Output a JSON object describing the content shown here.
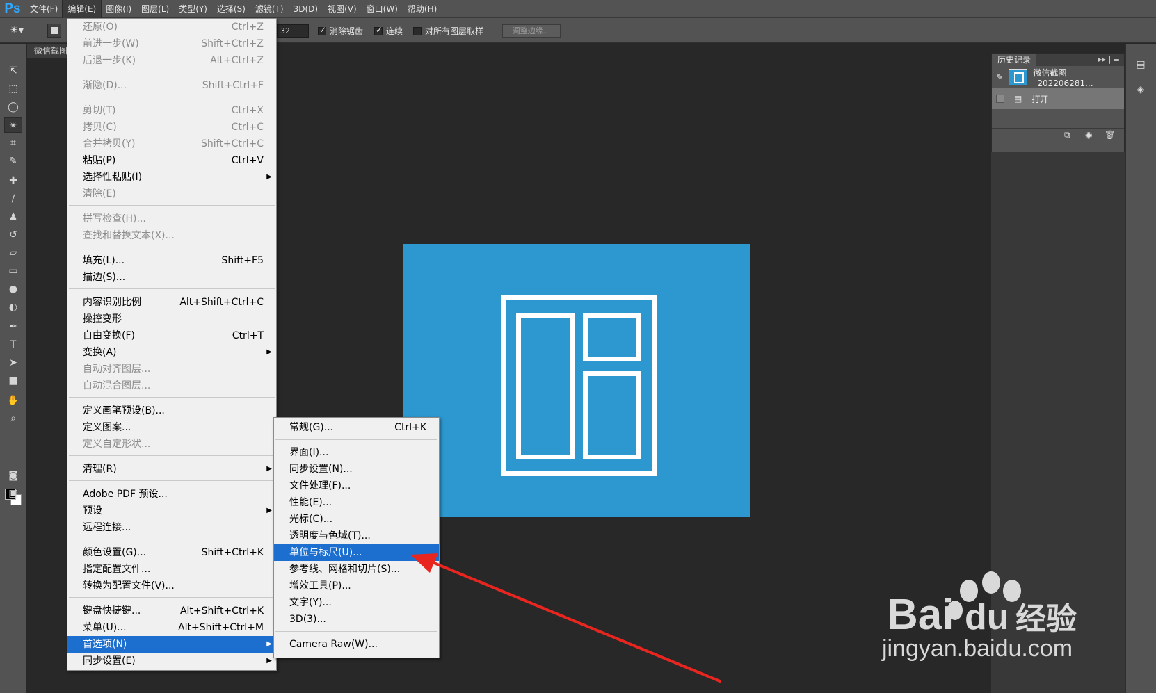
{
  "app": {
    "logo": "Ps"
  },
  "menubar": {
    "items": [
      "文件(F)",
      "编辑(E)",
      "图像(I)",
      "图层(L)",
      "类型(Y)",
      "选择(S)",
      "滤镜(T)",
      "3D(D)",
      "视图(V)",
      "窗口(W)",
      "帮助(H)"
    ],
    "active": "编辑(E)"
  },
  "options": {
    "tolerance": "32",
    "antialias_label": "消除锯齿",
    "contiguous_label": "连续",
    "all_layers_label": "对所有图层取样",
    "refine_button": "调整边缘..."
  },
  "document": {
    "tab_title": "微信截图"
  },
  "edit_menu": {
    "items": [
      {
        "label": "还原(O)",
        "shortcut": "Ctrl+Z",
        "disabled": true
      },
      {
        "label": "前进一步(W)",
        "shortcut": "Shift+Ctrl+Z",
        "disabled": true
      },
      {
        "label": "后退一步(K)",
        "shortcut": "Alt+Ctrl+Z",
        "disabled": true
      },
      {
        "label": "渐隐(D)...",
        "shortcut": "Shift+Ctrl+F",
        "disabled": true
      },
      {
        "label": "剪切(T)",
        "shortcut": "Ctrl+X",
        "disabled": true
      },
      {
        "label": "拷贝(C)",
        "shortcut": "Ctrl+C",
        "disabled": true
      },
      {
        "label": "合并拷贝(Y)",
        "shortcut": "Shift+Ctrl+C",
        "disabled": true
      },
      {
        "label": "粘贴(P)",
        "shortcut": "Ctrl+V",
        "disabled": false
      },
      {
        "label": "选择性粘贴(I)",
        "shortcut": "",
        "disabled": false,
        "submenu": true
      },
      {
        "label": "清除(E)",
        "shortcut": "",
        "disabled": true
      },
      {
        "label": "拼写检查(H)...",
        "shortcut": "",
        "disabled": true
      },
      {
        "label": "查找和替换文本(X)...",
        "shortcut": "",
        "disabled": true
      },
      {
        "label": "填充(L)...",
        "shortcut": "Shift+F5",
        "disabled": false
      },
      {
        "label": "描边(S)...",
        "shortcut": "",
        "disabled": false
      },
      {
        "label": "内容识别比例",
        "shortcut": "Alt+Shift+Ctrl+C",
        "disabled": false
      },
      {
        "label": "操控变形",
        "shortcut": "",
        "disabled": false
      },
      {
        "label": "自由变换(F)",
        "shortcut": "Ctrl+T",
        "disabled": false
      },
      {
        "label": "变换(A)",
        "shortcut": "",
        "disabled": false,
        "submenu": true
      },
      {
        "label": "自动对齐图层...",
        "shortcut": "",
        "disabled": true
      },
      {
        "label": "自动混合图层...",
        "shortcut": "",
        "disabled": true
      },
      {
        "label": "定义画笔预设(B)...",
        "shortcut": "",
        "disabled": false
      },
      {
        "label": "定义图案...",
        "shortcut": "",
        "disabled": false
      },
      {
        "label": "定义自定形状...",
        "shortcut": "",
        "disabled": true
      },
      {
        "label": "清理(R)",
        "shortcut": "",
        "disabled": false,
        "submenu": true
      },
      {
        "label": "Adobe PDF 预设...",
        "shortcut": "",
        "disabled": false
      },
      {
        "label": "预设",
        "shortcut": "",
        "disabled": false,
        "submenu": true
      },
      {
        "label": "远程连接...",
        "shortcut": "",
        "disabled": false
      },
      {
        "label": "颜色设置(G)...",
        "shortcut": "Shift+Ctrl+K",
        "disabled": false
      },
      {
        "label": "指定配置文件...",
        "shortcut": "",
        "disabled": false
      },
      {
        "label": "转换为配置文件(V)...",
        "shortcut": "",
        "disabled": false
      },
      {
        "label": "键盘快捷键...",
        "shortcut": "Alt+Shift+Ctrl+K",
        "disabled": false
      },
      {
        "label": "菜单(U)...",
        "shortcut": "Alt+Shift+Ctrl+M",
        "disabled": false
      },
      {
        "label": "首选项(N)",
        "shortcut": "",
        "disabled": false,
        "submenu": true,
        "highlighted": true
      },
      {
        "label": "同步设置(E)",
        "shortcut": "",
        "disabled": false,
        "submenu": true
      }
    ]
  },
  "prefs_submenu": {
    "items": [
      {
        "label": "常规(G)...",
        "shortcut": "Ctrl+K"
      },
      {
        "label": "界面(I)...",
        "shortcut": ""
      },
      {
        "label": "同步设置(N)...",
        "shortcut": ""
      },
      {
        "label": "文件处理(F)...",
        "shortcut": ""
      },
      {
        "label": "性能(E)...",
        "shortcut": ""
      },
      {
        "label": "光标(C)...",
        "shortcut": ""
      },
      {
        "label": "透明度与色域(T)...",
        "shortcut": ""
      },
      {
        "label": "单位与标尺(U)...",
        "shortcut": "",
        "highlighted": true
      },
      {
        "label": "参考线、网格和切片(S)...",
        "shortcut": ""
      },
      {
        "label": "增效工具(P)...",
        "shortcut": ""
      },
      {
        "label": "文字(Y)...",
        "shortcut": ""
      },
      {
        "label": "3D(3)...",
        "shortcut": ""
      },
      {
        "label": "Camera Raw(W)...",
        "shortcut": ""
      }
    ]
  },
  "history_panel": {
    "tab_label": "历史记录",
    "snapshot_label": "微信截图_202206281...",
    "state_label": "打开"
  },
  "watermark": {
    "text": "jingyan.baidu.com",
    "brand": "Bai",
    "brand2": "du",
    "brand3": "经验"
  },
  "colors": {
    "canvas_blue": "#2c98cf",
    "menu_highlight": "#1c6fcf",
    "annotation_arrow": "#e8261f"
  }
}
